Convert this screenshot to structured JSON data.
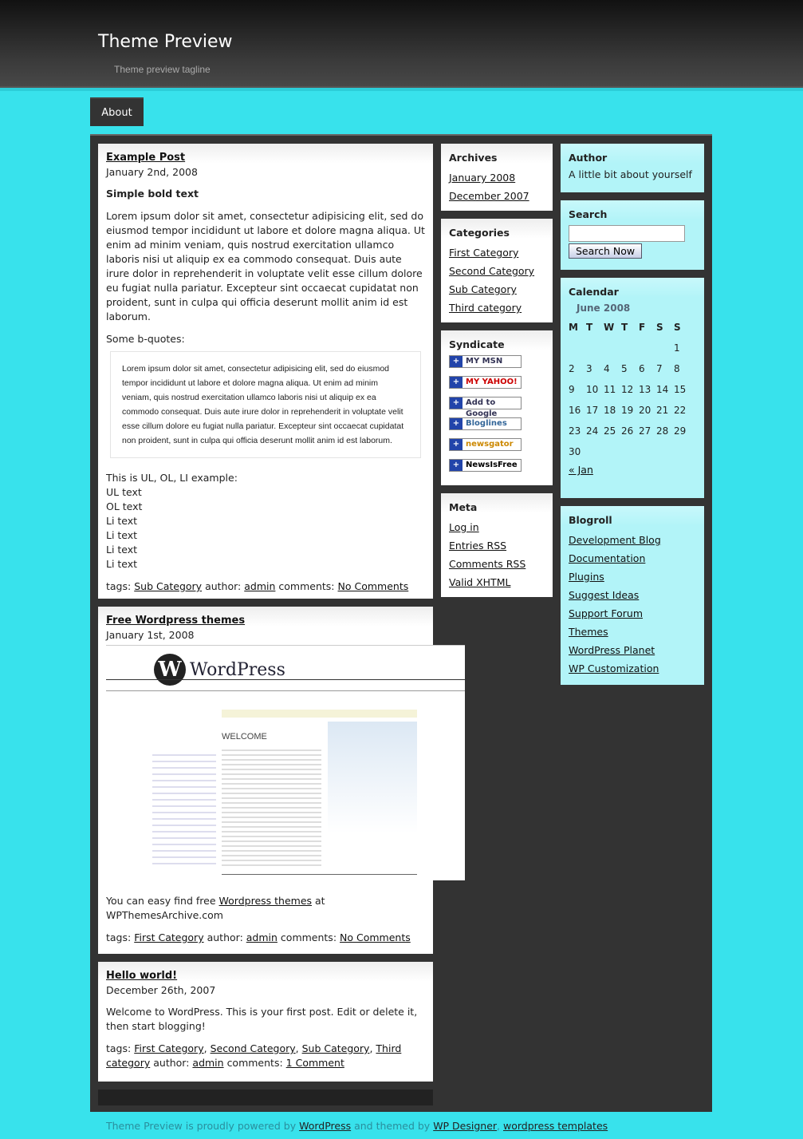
{
  "site": {
    "title": "Theme Preview",
    "tagline": "Theme preview tagline"
  },
  "nav": [
    {
      "label": "About"
    }
  ],
  "posts": [
    {
      "title": "Example Post",
      "date": "January 2nd, 2008",
      "bold": "Simple bold text",
      "para": "Lorem ipsum dolor sit amet, consectetur adipisicing elit, sed do eiusmod tempor incididunt ut labore et dolore magna aliqua. Ut enim ad minim veniam, quis nostrud exercitation ullamco laboris nisi ut aliquip ex ea commodo consequat. Duis aute irure dolor in reprehenderit in voluptate velit esse cillum dolore eu fugiat nulla pariatur. Excepteur sint occaecat cupidatat non proident, sunt in culpa qui officia deserunt mollit anim id est laborum.",
      "bq_intro": "Some b-quotes:",
      "quote": "Lorem ipsum dolor sit amet, consectetur adipisicing elit, sed do eiusmod tempor incididunt ut labore et dolore magna aliqua. Ut enim ad minim veniam, quis nostrud exercitation ullamco laboris nisi ut aliquip ex ea commodo consequat. Duis aute irure dolor in reprehenderit in voluptate velit esse cillum dolore eu fugiat nulla pariatur. Excepteur sint occaecat cupidatat non proident, sunt in culpa qui officia deserunt mollit anim id est laborum.",
      "list_intro": "This is UL, OL, LI example:",
      "list": [
        "UL text",
        "OL text",
        "Li text",
        "Li text",
        "Li text",
        "Li text"
      ],
      "tags_label": "tags:",
      "tags": [
        "Sub Category"
      ],
      "author_label": "author:",
      "author": "admin",
      "comments_label": "comments:",
      "comments": "No Comments"
    },
    {
      "title": "Free Wordpress themes",
      "date": "January 1st, 2008",
      "image_logo": "WordPress",
      "image_heading": "WELCOME",
      "text_before": "You can easy find free ",
      "link": "Wordpress themes",
      "text_after": " at WPThemesArchive.com",
      "tags_label": "tags:",
      "tags": [
        "First Category"
      ],
      "author_label": "author:",
      "author": "admin",
      "comments_label": "comments:",
      "comments": "No Comments"
    },
    {
      "title": "Hello world!",
      "date": "December 26th, 2007",
      "para": "Welcome to WordPress. This is your first post. Edit or delete it, then start blogging!",
      "tags_label": "tags:",
      "tags": [
        "First Category",
        "Second Category",
        "Sub Category",
        "Third category"
      ],
      "author_label": "author:",
      "author": "admin",
      "comments_label": "comments:",
      "comments": "1 Comment"
    }
  ],
  "archives": {
    "title": "Archives",
    "items": [
      "January 2008",
      "December 2007"
    ]
  },
  "categories": {
    "title": "Categories",
    "items": [
      "First Category",
      "Second Category",
      "Sub Category",
      "Third category"
    ]
  },
  "syndicate": {
    "title": "Syndicate",
    "items": [
      "MY MSN",
      "MY YAHOO!",
      "Add to Google",
      "Bloglines",
      "newsgator",
      "NewsIsFree"
    ]
  },
  "meta": {
    "title": "Meta",
    "items": [
      "Log in",
      "Entries RSS",
      "Comments RSS",
      "Valid XHTML"
    ]
  },
  "author": {
    "title": "Author",
    "text": "A little bit about yourself"
  },
  "search": {
    "title": "Search",
    "value": "",
    "button": "Search Now"
  },
  "calendar": {
    "title": "Calendar",
    "caption": "June 2008",
    "days": [
      "M",
      "T",
      "W",
      "T",
      "F",
      "S",
      "S"
    ],
    "weeks": [
      [
        "",
        "",
        "",
        "",
        "",
        "",
        "1"
      ],
      [
        "2",
        "3",
        "4",
        "5",
        "6",
        "7",
        "8"
      ],
      [
        "9",
        "10",
        "11",
        "12",
        "13",
        "14",
        "15"
      ],
      [
        "16",
        "17",
        "18",
        "19",
        "20",
        "21",
        "22"
      ],
      [
        "23",
        "24",
        "25",
        "26",
        "27",
        "28",
        "29"
      ],
      [
        "30",
        "",
        "",
        "",
        "",
        "",
        ""
      ]
    ],
    "prev": "« Jan"
  },
  "blogroll": {
    "title": "Blogroll",
    "items": [
      "Development Blog",
      "Documentation",
      "Plugins",
      "Suggest Ideas",
      "Support Forum",
      "Themes",
      "WordPress Planet",
      "WP Customization"
    ]
  },
  "footer": {
    "t1": "Theme Preview is proudly powered by ",
    "l1": "WordPress",
    "t2": " and themed by ",
    "l2": "WP Designer",
    "t3": ", ",
    "l3": "wordpress templates"
  },
  "colors": {
    "background": "#38e2ec",
    "container": "#333333",
    "widget_cyan": "#b2f4f8"
  }
}
